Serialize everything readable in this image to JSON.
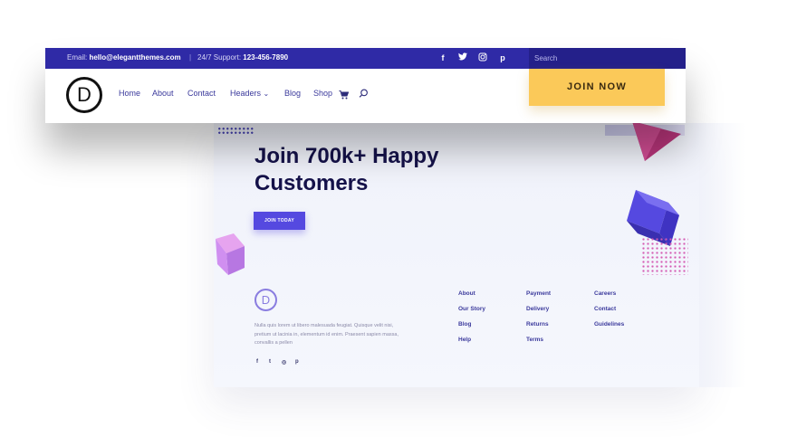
{
  "topbar": {
    "email_label": "Email:",
    "email": "hello@elegantthemes.com",
    "separator": "|",
    "support_label": "24/7 Support:",
    "support_phone": "123-456-7890",
    "social_icons": [
      "facebook-icon",
      "twitter-icon",
      "instagram-icon",
      "pinterest-icon"
    ],
    "social_glyphs": [
      "f",
      "t",
      "◎",
      "p"
    ]
  },
  "search": {
    "placeholder": "Search"
  },
  "logo": {
    "letter": "D"
  },
  "nav": {
    "items": [
      "Home",
      "About",
      "Contact",
      "Headers",
      "Blog",
      "Shop"
    ],
    "headers_chevron": "⌄",
    "cart_icon": "cart-icon",
    "search_icon": "search-icon"
  },
  "cta": {
    "join_now": "JOIN NOW"
  },
  "hero": {
    "title": "Join 700k+ Happy Customers",
    "button": "JOIN TODAY"
  },
  "footer": {
    "logo_letter": "D",
    "text": "Nulla quis lorem ut libero malesuada feugiat. Quisque velit nisi, pretium ut lacinia in, elementum id enim. Praesent sapien massa, convallis a pellen",
    "social_glyphs": [
      "f",
      "t",
      "◎",
      "p"
    ],
    "col1": [
      "About",
      "Our Story",
      "Blog",
      "Help"
    ],
    "col2": [
      "Payment",
      "Delivery",
      "Returns",
      "Terms"
    ],
    "col3": [
      "Careers",
      "Contact",
      "Guidelines"
    ]
  },
  "colors": {
    "topbar": "#2f2aa6",
    "accent": "#5549e0",
    "cta": "#fbc959",
    "heading": "#15124a"
  }
}
